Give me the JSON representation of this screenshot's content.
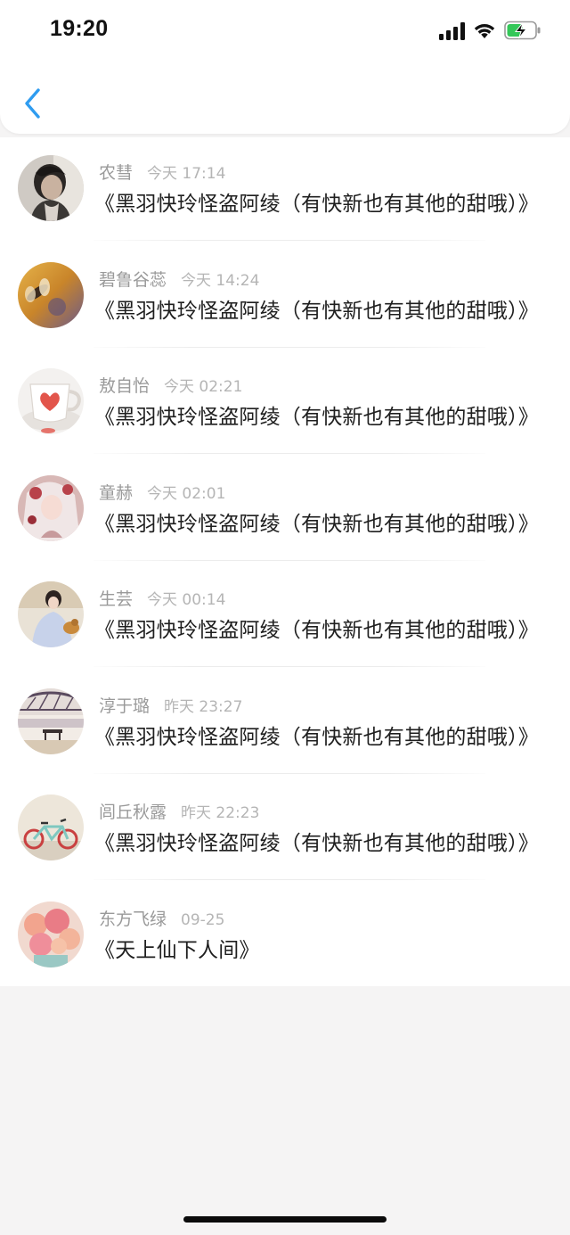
{
  "status_bar": {
    "time": "19:20"
  },
  "nav": {
    "back_icon": "chevron-left-icon",
    "accent_color": "#2f9cf0"
  },
  "comments": [
    {
      "name": "农彗",
      "time": "今天 17:14",
      "text": "《黑羽快玲怪盗阿绫（有快新也有其他的甜哦）》",
      "avatar": "avatar-boy-portrait"
    },
    {
      "name": "碧鲁谷蕊",
      "time": "今天 14:24",
      "text": "《黑羽快玲怪盗阿绫（有快新也有其他的甜哦）》",
      "avatar": "avatar-dragonfly"
    },
    {
      "name": "敖自怡",
      "time": "今天 02:21",
      "text": "《黑羽快玲怪盗阿绫（有快新也有其他的甜哦）》",
      "avatar": "avatar-heart-cup"
    },
    {
      "name": "童赫",
      "time": "今天 02:01",
      "text": "《黑羽快玲怪盗阿绫（有快新也有其他的甜哦）》",
      "avatar": "avatar-anime-girl"
    },
    {
      "name": "生芸",
      "time": "今天 00:14",
      "text": "《黑羽快玲怪盗阿绫（有快新也有其他的甜哦）》",
      "avatar": "avatar-girl-with-dog"
    },
    {
      "name": "淳于璐",
      "time": "昨天 23:27",
      "text": "《黑羽快玲怪盗阿绫（有快新也有其他的甜哦）》",
      "avatar": "avatar-bridge-bench"
    },
    {
      "name": "闾丘秋露",
      "time": "昨天 22:23",
      "text": "《黑羽快玲怪盗阿绫（有快新也有其他的甜哦）》",
      "avatar": "avatar-bicycle"
    },
    {
      "name": "东方飞绿",
      "time": "09-25",
      "text": "《天上仙下人间》",
      "avatar": "avatar-flowers"
    }
  ]
}
